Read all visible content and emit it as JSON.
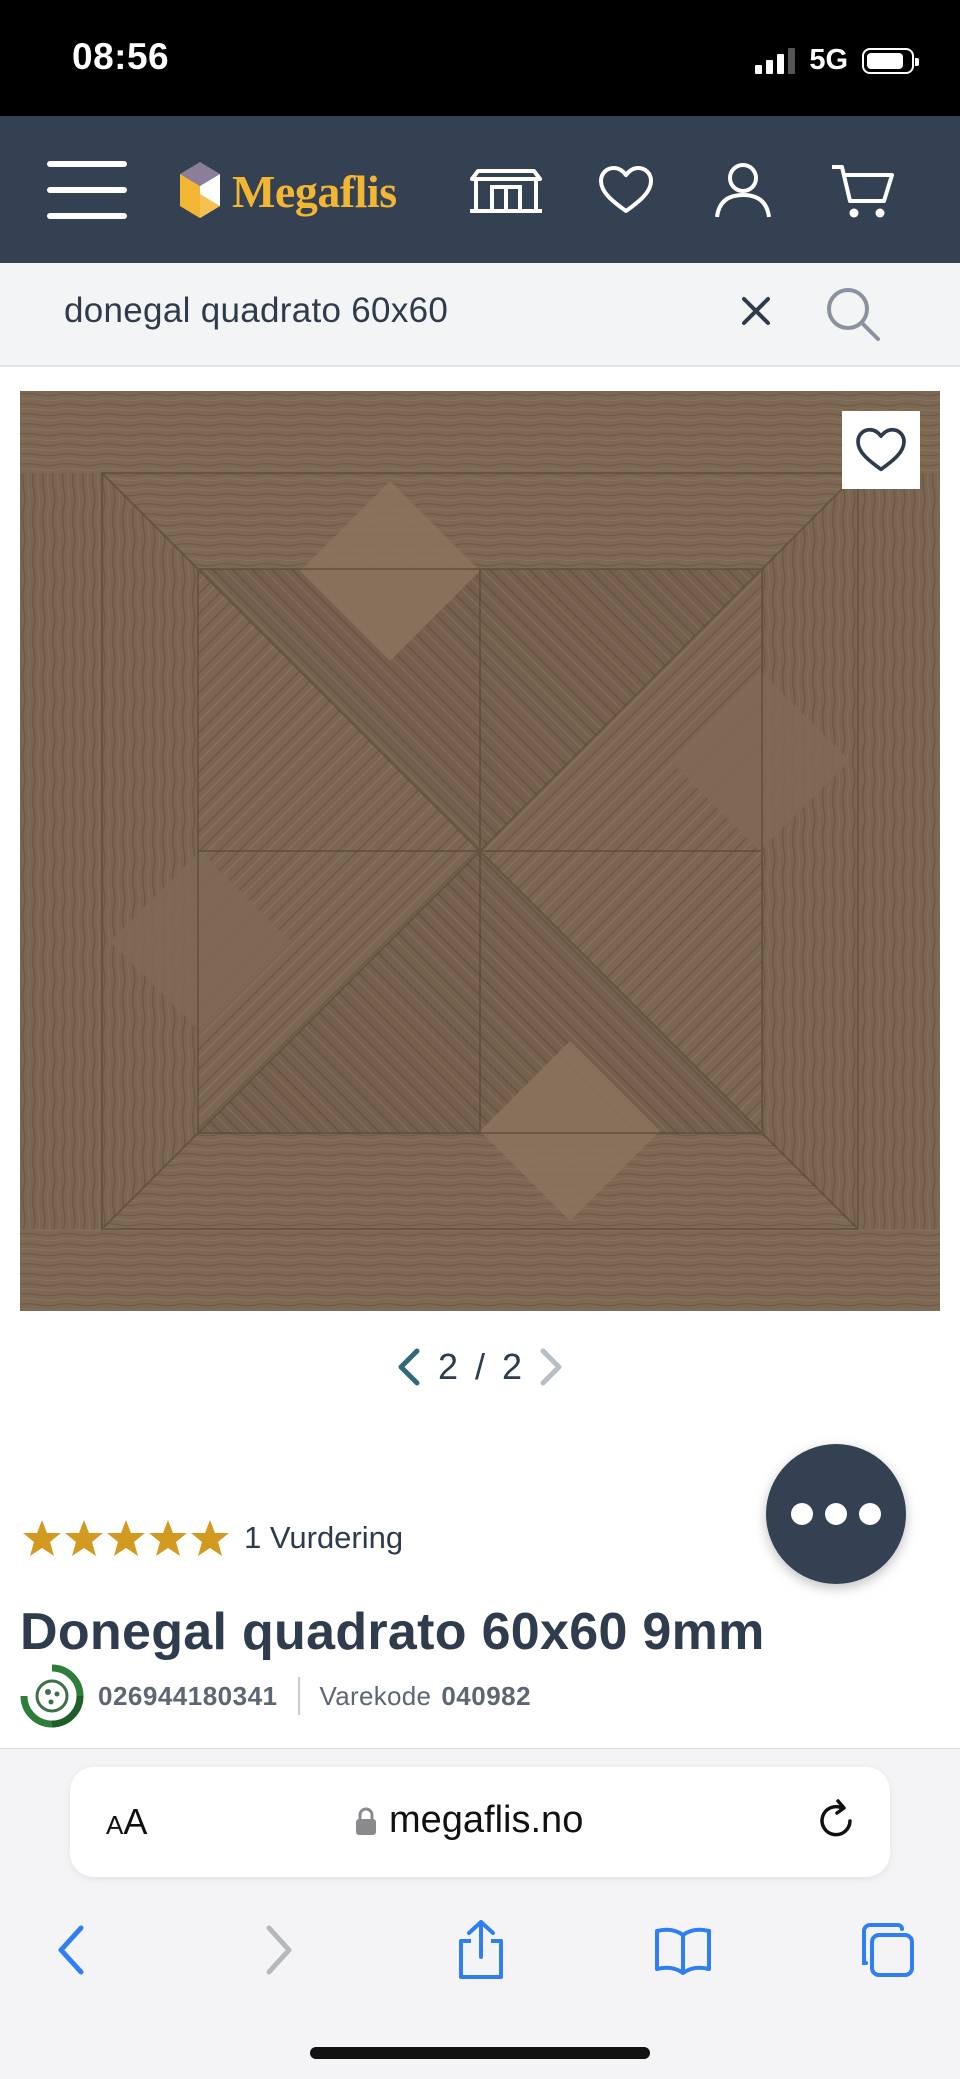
{
  "status_bar": {
    "time": "08:56",
    "network": "5G",
    "battery_level": 0.85
  },
  "header": {
    "logo_text": "Megaflis",
    "brand_color": "#f2b632",
    "header_bg": "#334153",
    "icons": [
      "menu-icon",
      "showroom-icon",
      "heart-icon",
      "user-icon",
      "cart-icon"
    ]
  },
  "search": {
    "value": "donegal quadrato 60x60"
  },
  "gallery": {
    "current": "2",
    "separator": "/",
    "total": "2"
  },
  "product": {
    "rating": 5,
    "rating_count": "1 Vurdering",
    "title": "Donegal quadrato 60x60 9mm",
    "ean": "026944180341",
    "varekode_label": "Varekode",
    "varekode_value": "040982"
  },
  "safari": {
    "aa_small": "A",
    "aa_large": "A",
    "domain": "megaflis.no"
  },
  "colors": {
    "star": "#d39a21",
    "accent_blue": "#2f7ef6",
    "pager_arrow": "#2f6a7a"
  }
}
